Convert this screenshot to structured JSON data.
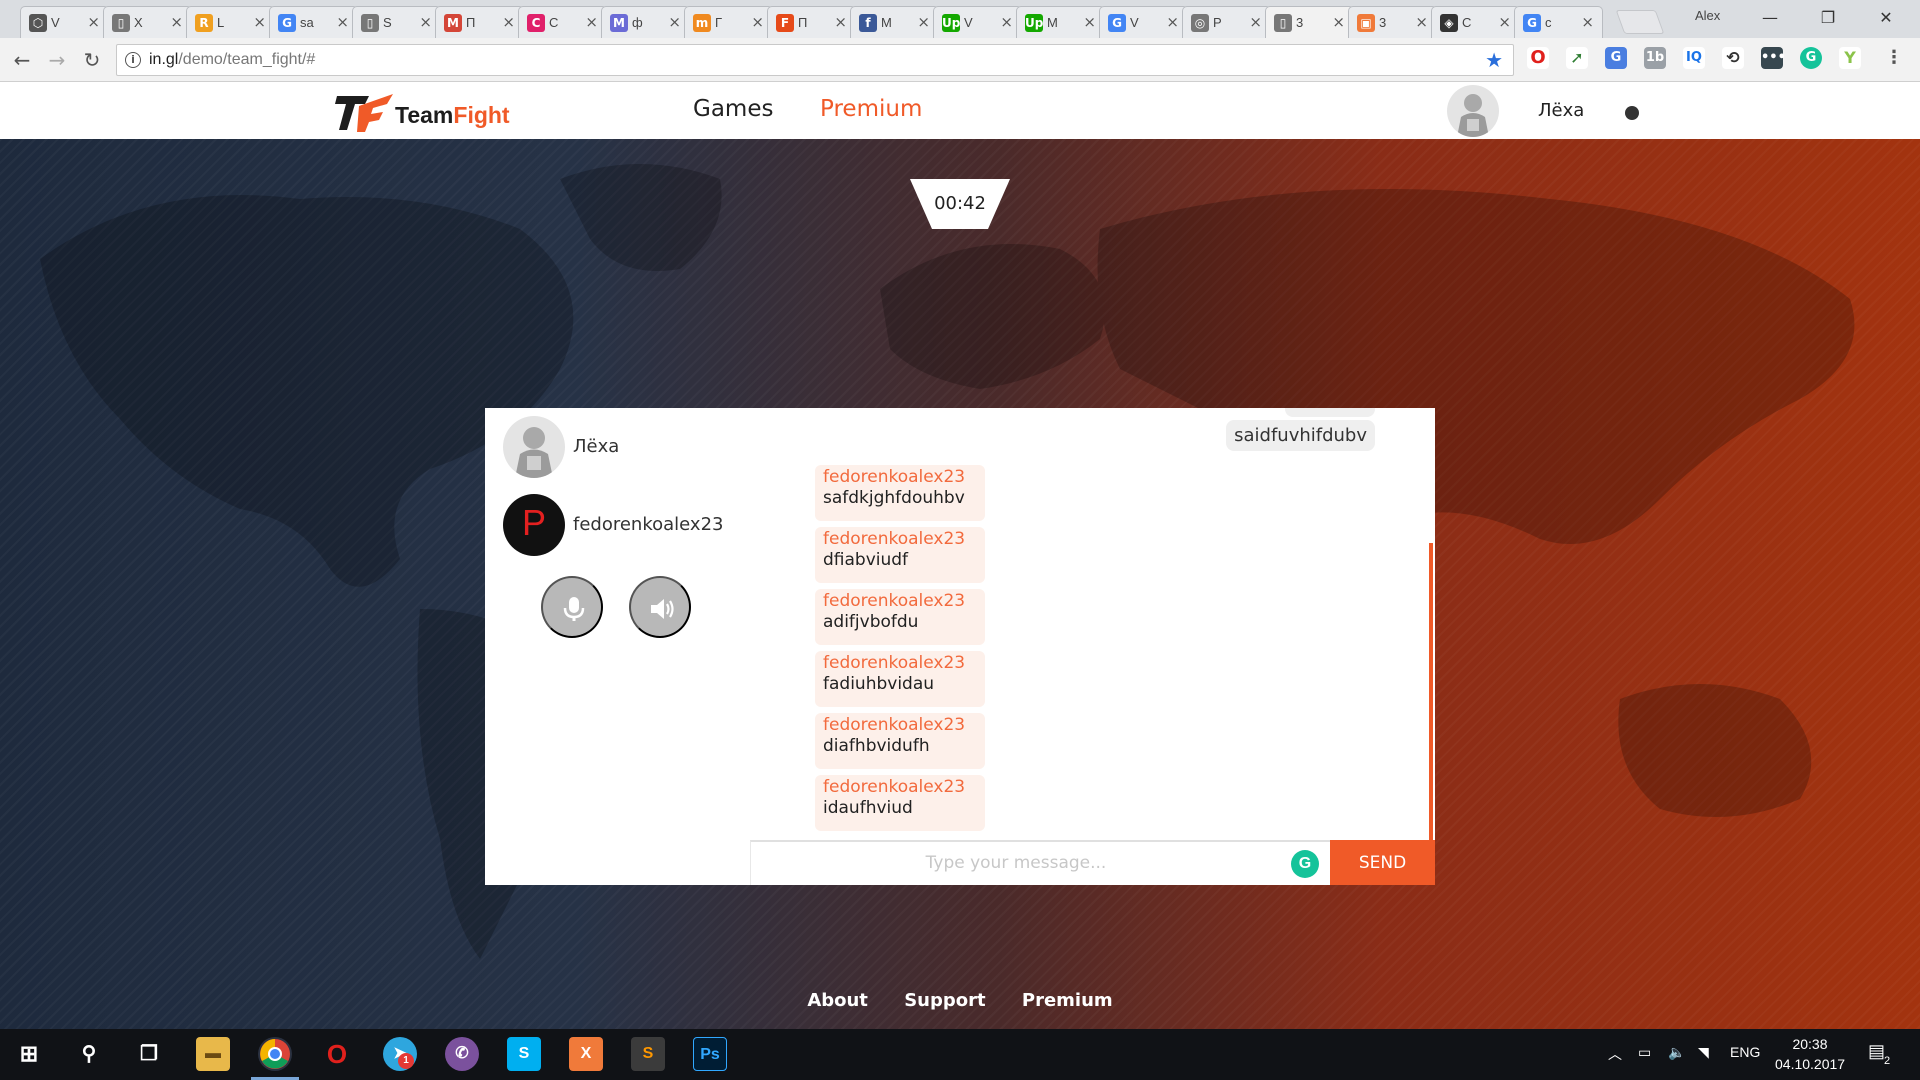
{
  "browser": {
    "tabs": [
      {
        "label": "V",
        "color": "#555",
        "glyph": "⬡"
      },
      {
        "label": "X",
        "color": "#777",
        "glyph": "▯"
      },
      {
        "label": "L",
        "color": "#f0a020",
        "glyph": "R"
      },
      {
        "label": "sa",
        "color": "#4285f4",
        "glyph": "G"
      },
      {
        "label": "S",
        "color": "#777",
        "glyph": "▯"
      },
      {
        "label": "П",
        "color": "#d44638",
        "glyph": "M"
      },
      {
        "label": "С",
        "color": "#e0206a",
        "glyph": "C"
      },
      {
        "label": "ф",
        "color": "#6b6bd6",
        "glyph": "M"
      },
      {
        "label": "Г",
        "color": "#f08a20",
        "glyph": "m"
      },
      {
        "label": "П",
        "color": "#e64a19",
        "glyph": "F"
      },
      {
        "label": "M",
        "color": "#3b5998",
        "glyph": "f"
      },
      {
        "label": "V",
        "color": "#14a800",
        "glyph": "Up"
      },
      {
        "label": "M",
        "color": "#14a800",
        "glyph": "Up"
      },
      {
        "label": "V",
        "color": "#4285f4",
        "glyph": "G"
      },
      {
        "label": "P",
        "color": "#777",
        "glyph": "◎"
      },
      {
        "label": "3",
        "color": "#777",
        "glyph": "▯"
      },
      {
        "label": "3",
        "color": "#f07a3a",
        "glyph": "▣"
      },
      {
        "label": "С",
        "color": "#333",
        "glyph": "◈"
      },
      {
        "label": "c",
        "color": "#4285f4",
        "glyph": "G"
      }
    ],
    "window_user": "Alex",
    "url_host": "in.gl",
    "url_path": "/demo/team_fight/#"
  },
  "site": {
    "logo_part1": "Team",
    "logo_part2": "Fight",
    "nav": {
      "games": "Games",
      "premium": "Premium"
    },
    "username": "Лёха",
    "accent_color": "#f05a28"
  },
  "timer": "00:42",
  "chat": {
    "participants": [
      {
        "name": "Лёха"
      },
      {
        "name": "fedorenkoalex23",
        "initial": "P"
      }
    ],
    "self_message": "saidfuvhifdubv",
    "messages": [
      {
        "author": "fedorenkoalex23",
        "text": "safdkjghfdouhbv"
      },
      {
        "author": "fedorenkoalex23",
        "text": "dfiabviudf"
      },
      {
        "author": "fedorenkoalex23",
        "text": "adifjvbofdu"
      },
      {
        "author": "fedorenkoalex23",
        "text": "fadiuhbvidau"
      },
      {
        "author": "fedorenkoalex23",
        "text": "diafhbvidufh"
      },
      {
        "author": "fedorenkoalex23",
        "text": "idaufhviud"
      }
    ],
    "input_placeholder": "Type your message...",
    "send_label": "SEND"
  },
  "footer": {
    "about": "About",
    "support": "Support",
    "premium": "Premium"
  },
  "taskbar": {
    "language": "ENG",
    "time": "20:38",
    "date": "04.10.2017",
    "notifications": "2",
    "telegram_badge": "1"
  }
}
